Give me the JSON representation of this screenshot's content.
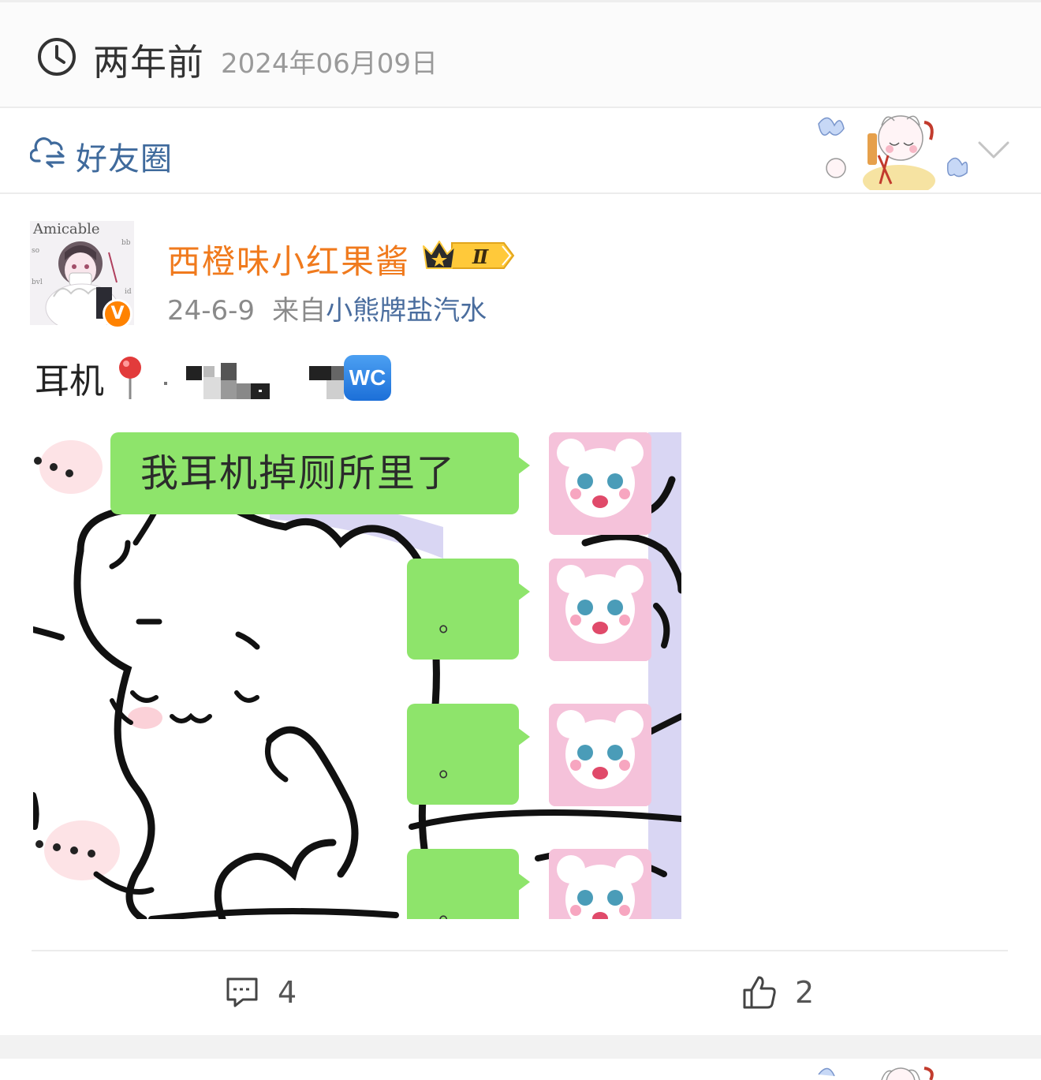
{
  "time_header": {
    "relative": "两年前",
    "absolute": "2024年06月09日",
    "icon": "clock-icon"
  },
  "visibility": {
    "label": "好友圈",
    "icon": "cloud-friends-icon",
    "expand_icon": "chevron-down-icon"
  },
  "post": {
    "author": {
      "name": "西橙味小红果酱",
      "verified_badge": "V",
      "vip_level": "Ⅱ",
      "name_color": "#f07a1d"
    },
    "date": "24-6-9",
    "source_prefix": "来自",
    "source": "小熊牌盐汽水",
    "text": "耳机",
    "emoji": [
      "round-pushpin",
      "wc"
    ],
    "wc_label": "WC",
    "image": {
      "main_bubble": "我耳机掉厕所里了",
      "reply_bubbles": [
        "。",
        "。",
        "。",
        "。"
      ]
    }
  },
  "actions": {
    "comments": {
      "icon": "comment-icon",
      "count": "4"
    },
    "likes": {
      "icon": "thumbs-up-icon",
      "count": "2"
    }
  },
  "colors": {
    "link_blue": "#4a6d9e",
    "visibility_blue": "#3f6a9c",
    "bubble_green": "#8ee46b",
    "verified_orange": "#ff8200"
  }
}
